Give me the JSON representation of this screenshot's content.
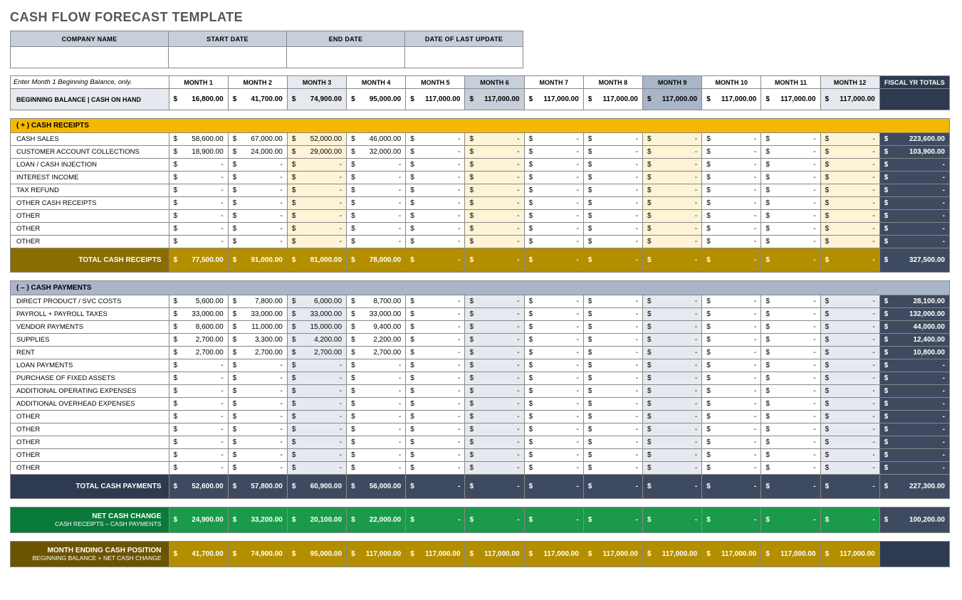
{
  "title": "CASH FLOW FORECAST TEMPLATE",
  "info_headers": [
    "COMPANY NAME",
    "START DATE",
    "END DATE",
    "DATE OF LAST UPDATE"
  ],
  "note": "Enter Month 1 Beginning Balance, only.",
  "month_headers": [
    "MONTH 1",
    "MONTH 2",
    "MONTH 3",
    "MONTH 4",
    "MONTH 5",
    "MONTH 6",
    "MONTH 7",
    "MONTH 8",
    "MONTH 9",
    "MONTH 10",
    "MONTH 11",
    "MONTH 12"
  ],
  "fiscal_header": "FISCAL YR TOTALS",
  "beginning_label": "BEGINNING BALANCE | CASH ON HAND",
  "beginning": [
    "16,800.00",
    "41,700.00",
    "74,900.00",
    "95,000.00",
    "117,000.00",
    "117,000.00",
    "117,000.00",
    "117,000.00",
    "117,000.00",
    "117,000.00",
    "117,000.00",
    "117,000.00"
  ],
  "receipts_header": "( + )   CASH RECEIPTS",
  "receipts_rows": [
    {
      "label": "CASH SALES",
      "vals": [
        "58,600.00",
        "67,000.00",
        "52,000.00",
        "46,000.00",
        "-",
        "-",
        "-",
        "-",
        "-",
        "-",
        "-",
        "-"
      ],
      "total": "223,600.00"
    },
    {
      "label": "CUSTOMER ACCOUNT COLLECTIONS",
      "vals": [
        "18,900.00",
        "24,000.00",
        "29,000.00",
        "32,000.00",
        "-",
        "-",
        "-",
        "-",
        "-",
        "-",
        "-",
        "-"
      ],
      "total": "103,900.00"
    },
    {
      "label": "LOAN / CASH INJECTION",
      "vals": [
        "-",
        "-",
        "-",
        "-",
        "-",
        "-",
        "-",
        "-",
        "-",
        "-",
        "-",
        "-"
      ],
      "total": "-"
    },
    {
      "label": "INTEREST INCOME",
      "vals": [
        "-",
        "-",
        "-",
        "-",
        "-",
        "-",
        "-",
        "-",
        "-",
        "-",
        "-",
        "-"
      ],
      "total": "-"
    },
    {
      "label": "TAX REFUND",
      "vals": [
        "-",
        "-",
        "-",
        "-",
        "-",
        "-",
        "-",
        "-",
        "-",
        "-",
        "-",
        "-"
      ],
      "total": "-"
    },
    {
      "label": "OTHER CASH RECEIPTS",
      "vals": [
        "-",
        "-",
        "-",
        "-",
        "-",
        "-",
        "-",
        "-",
        "-",
        "-",
        "-",
        "-"
      ],
      "total": "-"
    },
    {
      "label": "OTHER",
      "vals": [
        "-",
        "-",
        "-",
        "-",
        "-",
        "-",
        "-",
        "-",
        "-",
        "-",
        "-",
        "-"
      ],
      "total": "-"
    },
    {
      "label": "OTHER",
      "vals": [
        "-",
        "-",
        "-",
        "-",
        "-",
        "-",
        "-",
        "-",
        "-",
        "-",
        "-",
        "-"
      ],
      "total": "-"
    },
    {
      "label": "OTHER",
      "vals": [
        "-",
        "-",
        "-",
        "-",
        "-",
        "-",
        "-",
        "-",
        "-",
        "-",
        "-",
        "-"
      ],
      "total": "-"
    }
  ],
  "receipts_total_label": "TOTAL CASH RECEIPTS",
  "receipts_totals": [
    "77,500.00",
    "91,000.00",
    "81,000.00",
    "78,000.00",
    "-",
    "-",
    "-",
    "-",
    "-",
    "-",
    "-",
    "-"
  ],
  "receipts_grand": "327,500.00",
  "payments_header": "( – )   CASH PAYMENTS",
  "payments_rows": [
    {
      "label": "DIRECT PRODUCT / SVC COSTS",
      "vals": [
        "5,600.00",
        "7,800.00",
        "6,000.00",
        "8,700.00",
        "-",
        "-",
        "-",
        "-",
        "-",
        "-",
        "-",
        "-"
      ],
      "total": "28,100.00"
    },
    {
      "label": "PAYROLL + PAYROLL TAXES",
      "vals": [
        "33,000.00",
        "33,000.00",
        "33,000.00",
        "33,000.00",
        "-",
        "-",
        "-",
        "-",
        "-",
        "-",
        "-",
        "-"
      ],
      "total": "132,000.00"
    },
    {
      "label": "VENDOR PAYMENTS",
      "vals": [
        "8,600.00",
        "11,000.00",
        "15,000.00",
        "9,400.00",
        "-",
        "-",
        "-",
        "-",
        "-",
        "-",
        "-",
        "-"
      ],
      "total": "44,000.00"
    },
    {
      "label": "SUPPLIES",
      "vals": [
        "2,700.00",
        "3,300.00",
        "4,200.00",
        "2,200.00",
        "-",
        "-",
        "-",
        "-",
        "-",
        "-",
        "-",
        "-"
      ],
      "total": "12,400.00"
    },
    {
      "label": "RENT",
      "vals": [
        "2,700.00",
        "2,700.00",
        "2,700.00",
        "2,700.00",
        "-",
        "-",
        "-",
        "-",
        "-",
        "-",
        "-",
        "-"
      ],
      "total": "10,800.00"
    },
    {
      "label": "LOAN PAYMENTS",
      "vals": [
        "-",
        "-",
        "-",
        "-",
        "-",
        "-",
        "-",
        "-",
        "-",
        "-",
        "-",
        "-"
      ],
      "total": "-"
    },
    {
      "label": "PURCHASE OF FIXED ASSETS",
      "vals": [
        "-",
        "-",
        "-",
        "-",
        "-",
        "-",
        "-",
        "-",
        "-",
        "-",
        "-",
        "-"
      ],
      "total": "-"
    },
    {
      "label": "ADDITIONAL OPERATING EXPENSES",
      "vals": [
        "-",
        "-",
        "-",
        "-",
        "-",
        "-",
        "-",
        "-",
        "-",
        "-",
        "-",
        "-"
      ],
      "total": "-"
    },
    {
      "label": "ADDITIONAL OVERHEAD EXPENSES",
      "vals": [
        "-",
        "-",
        "-",
        "-",
        "-",
        "-",
        "-",
        "-",
        "-",
        "-",
        "-",
        "-"
      ],
      "total": "-"
    },
    {
      "label": "OTHER",
      "vals": [
        "-",
        "-",
        "-",
        "-",
        "-",
        "-",
        "-",
        "-",
        "-",
        "-",
        "-",
        "-"
      ],
      "total": "-"
    },
    {
      "label": "OTHER",
      "vals": [
        "-",
        "-",
        "-",
        "-",
        "-",
        "-",
        "-",
        "-",
        "-",
        "-",
        "-",
        "-"
      ],
      "total": "-"
    },
    {
      "label": "OTHER",
      "vals": [
        "-",
        "-",
        "-",
        "-",
        "-",
        "-",
        "-",
        "-",
        "-",
        "-",
        "-",
        "-"
      ],
      "total": "-"
    },
    {
      "label": "OTHER",
      "vals": [
        "-",
        "-",
        "-",
        "-",
        "-",
        "-",
        "-",
        "-",
        "-",
        "-",
        "-",
        "-"
      ],
      "total": "-"
    },
    {
      "label": "OTHER",
      "vals": [
        "-",
        "-",
        "-",
        "-",
        "-",
        "-",
        "-",
        "-",
        "-",
        "-",
        "-",
        "-"
      ],
      "total": "-"
    }
  ],
  "payments_total_label": "TOTAL CASH PAYMENTS",
  "payments_totals": [
    "52,600.00",
    "57,800.00",
    "60,900.00",
    "56,000.00",
    "-",
    "-",
    "-",
    "-",
    "-",
    "-",
    "-",
    "-"
  ],
  "payments_grand": "227,300.00",
  "net_label": "NET CASH CHANGE",
  "net_sub": "CASH RECEIPTS – CASH PAYMENTS",
  "net_vals": [
    "24,900.00",
    "33,200.00",
    "20,100.00",
    "22,000.00",
    "-",
    "-",
    "-",
    "-",
    "-",
    "-",
    "-",
    "-"
  ],
  "net_grand": "100,200.00",
  "end_label": "MONTH ENDING CASH POSITION",
  "end_sub": "BEGINNING BALANCE + NET CASH CHANGE",
  "end_vals": [
    "41,700.00",
    "74,900.00",
    "95,000.00",
    "117,000.00",
    "117,000.00",
    "117,000.00",
    "117,000.00",
    "117,000.00",
    "117,000.00",
    "117,000.00",
    "117,000.00",
    "117,000.00"
  ]
}
